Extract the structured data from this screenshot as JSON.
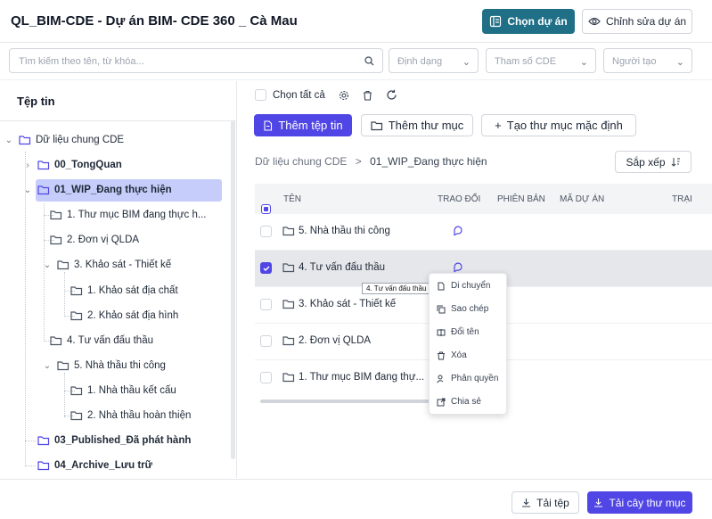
{
  "header": {
    "title": "QL_BIM-CDE - Dự án BIM- CDE 360 _ Cà Mau",
    "choose_project": "Chọn dự án",
    "edit_project": "Chỉnh sửa dự án"
  },
  "filters": {
    "search_placeholder": "Tìm kiếm theo tên, từ khóa...",
    "format": "Định dạng",
    "param": "Tham số CDE",
    "creator": "Người tạo"
  },
  "tree": {
    "heading": "Tệp tin",
    "items": [
      {
        "label": "Dữ liệu chung CDE"
      },
      {
        "label": "00_TongQuan"
      },
      {
        "label": "01_WIP_Đang thực hiện"
      },
      {
        "label": "1. Thư mục BIM đang thực h..."
      },
      {
        "label": "2. Đơn vị QLDA"
      },
      {
        "label": "3. Khảo sát - Thiết kế"
      },
      {
        "label": "1. Khảo sát địa chất"
      },
      {
        "label": "2. Khảo sát địa hình"
      },
      {
        "label": "4. Tư vấn đấu thầu"
      },
      {
        "label": "5. Nhà thầu thi công"
      },
      {
        "label": "1. Nhà thầu kết cấu"
      },
      {
        "label": "2. Nhà thầu hoàn thiện"
      },
      {
        "label": "03_Published_Đã phát hành"
      },
      {
        "label": "04_Archive_Lưu trữ"
      }
    ]
  },
  "toolbar": {
    "select_all": "Chọn tất cả",
    "add_file": "Thêm tệp tin",
    "add_folder": "Thêm thư mục",
    "create_default": "Tạo thư mục mặc định",
    "sort": "Sắp xếp"
  },
  "breadcrumb": {
    "root": "Dữ liệu chung CDE",
    "sep": ">",
    "current": "01_WIP_Đang thực hiện"
  },
  "table": {
    "columns": [
      "TÊN",
      "TRAO ĐỔI",
      "PHIÊN BẢN",
      "MÃ DỰ ÁN",
      "TRẠI"
    ],
    "rows": [
      {
        "name": "5. Nhà thầu thi công",
        "checked": false
      },
      {
        "name": "4. Tư vấn đấu thầu",
        "checked": true
      },
      {
        "name": "3. Khảo sát - Thiết kế",
        "checked": false
      },
      {
        "name": "2. Đơn vị QLDA",
        "checked": false
      },
      {
        "name": "1. Thư mục BIM đang thự...",
        "checked": false
      }
    ]
  },
  "tooltip": "4. Tư vấn đấu thầu",
  "context_menu": {
    "items": [
      "Di chuyển",
      "Sao chép",
      "Đổi tên",
      "Xóa",
      "Phân quyền",
      "Chia sẻ"
    ]
  },
  "footer": {
    "download": "Tải tệp",
    "download_tree": "Tải cây thư mục"
  },
  "colors": {
    "primary": "#1f6f86",
    "accent": "#5046e5",
    "selected": "#c7cdfa"
  }
}
